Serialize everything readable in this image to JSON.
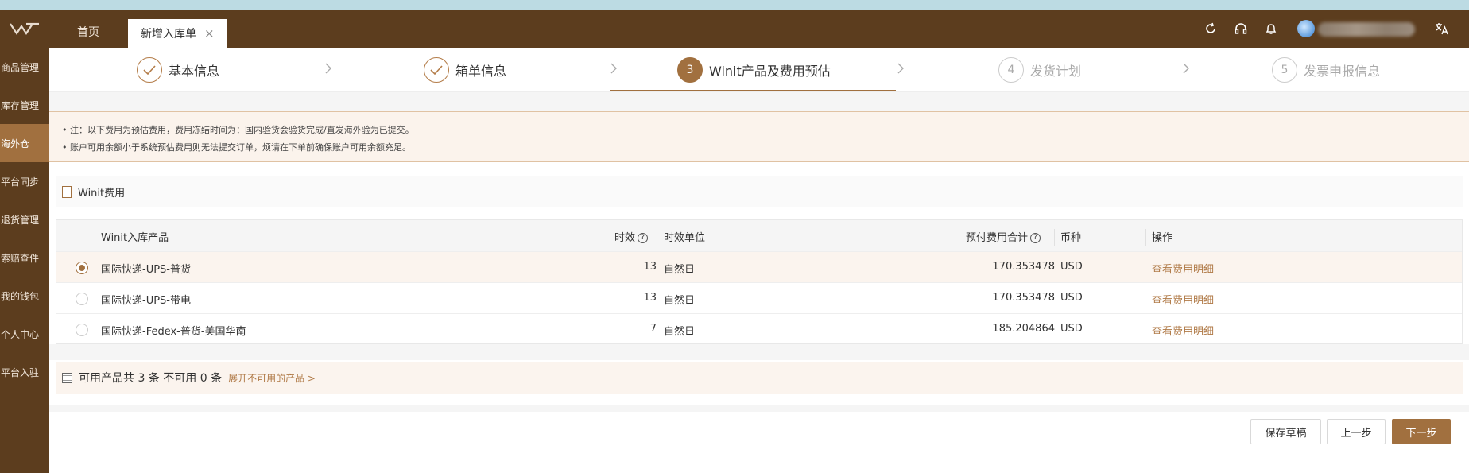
{
  "topbar": {
    "home_tab": "首页",
    "active_tab": "新增入库单",
    "close_glyph": "×",
    "icons": [
      "refresh-icon",
      "headset-icon",
      "bell-icon",
      "translate-icon"
    ]
  },
  "sidebar": {
    "items": [
      {
        "label": "商品管理"
      },
      {
        "label": "库存管理"
      },
      {
        "label": "海外仓",
        "active": true
      },
      {
        "label": "平台同步"
      },
      {
        "label": "退货管理"
      },
      {
        "label": "索赔查件"
      },
      {
        "label": "我的钱包"
      },
      {
        "label": "个人中心"
      },
      {
        "label": "平台入驻"
      }
    ]
  },
  "steps": [
    {
      "label": "基本信息",
      "state": "done"
    },
    {
      "label": "箱单信息",
      "state": "done"
    },
    {
      "num": "3",
      "label": "Winit产品及费用预估",
      "state": "active"
    },
    {
      "num": "4",
      "label": "发货计划",
      "state": "pending"
    },
    {
      "num": "5",
      "label": "发票申报信息",
      "state": "pending"
    }
  ],
  "notice": {
    "line1": "• 注：以下费用为预估费用，费用冻结时间为：国内验货会验货完成/直发海外验为已提交。",
    "line2": "• 账户可用余额小于系统预估费用则无法提交订单，烦请在下单前确保账户可用余额充足。"
  },
  "fee_section": {
    "title": "Winit费用"
  },
  "table": {
    "headers": {
      "product": "Winit入库产品",
      "timeliness": "时效",
      "unit": "时效单位",
      "total": "预付费用合计",
      "currency": "币种",
      "action": "操作"
    },
    "rows": [
      {
        "product": "国际快递-UPS-普货",
        "timeliness": "13",
        "unit": "自然日",
        "total": "170.353478",
        "currency": "USD",
        "action": "查看费用明细",
        "selected": true
      },
      {
        "product": "国际快递-UPS-带电",
        "timeliness": "13",
        "unit": "自然日",
        "total": "170.353478",
        "currency": "USD",
        "action": "查看费用明细",
        "selected": false
      },
      {
        "product": "国际快递-Fedex-普货-美国华南",
        "timeliness": "7",
        "unit": "自然日",
        "total": "185.204864",
        "currency": "USD",
        "action": "查看费用明细",
        "selected": false
      }
    ]
  },
  "availability": {
    "summary": "可用产品共 3 条 不可用 0 条",
    "expand": "展开不可用的产品 >"
  },
  "buttons": {
    "save_draft": "保存草稿",
    "prev": "上一步",
    "next": "下一步"
  },
  "colors": {
    "brand_dark": "#5c3d1e",
    "brand_accent": "#a1703f",
    "link": "#b07a47"
  }
}
